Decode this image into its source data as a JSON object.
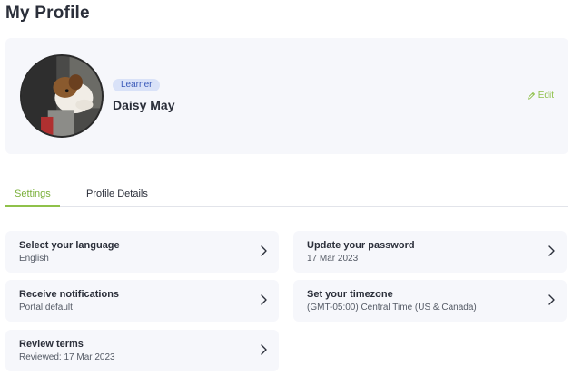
{
  "page": {
    "title": "My Profile"
  },
  "profile": {
    "role": "Learner",
    "name": "Daisy May",
    "edit_label": "Edit",
    "avatar_icon": "dog-photo",
    "edit_icon": "pencil-icon"
  },
  "tabs": [
    {
      "label": "Settings",
      "active": true
    },
    {
      "label": "Profile Details",
      "active": false
    }
  ],
  "settings": {
    "language": {
      "title": "Select your language",
      "value": "English"
    },
    "notifications": {
      "title": "Receive notifications",
      "value": "Portal default"
    },
    "terms": {
      "title": "Review terms",
      "value": "Reviewed: 17 Mar 2023"
    },
    "password": {
      "title": "Update your password",
      "value": "17 Mar 2023"
    },
    "timezone": {
      "title": "Set your timezone",
      "value": "(GMT-05:00) Central Time (US & Canada)"
    }
  },
  "colors": {
    "accent": "#8fc14a",
    "card_bg": "#f6f7fb",
    "badge_bg": "#d9e2f8",
    "badge_text": "#3a59b8"
  }
}
